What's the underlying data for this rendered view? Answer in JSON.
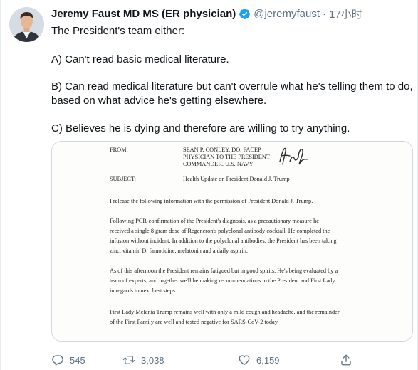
{
  "author": {
    "display_name": "Jeremy Faust MD MS (ER physician)",
    "handle": "@jeremyfaust",
    "separator": "·",
    "timestamp": "17小时"
  },
  "tweet_text": {
    "line1": "The President's team either:",
    "line2": "A) Can't read basic medical literature.",
    "line3": "B) Can read medical literature but can't overrule what he's telling them to do,",
    "line4": "based on what advice he's getting elsewhere.",
    "line5": "C) Believes he is dying and therefore are willing to try anything."
  },
  "memo": {
    "from_label": "FROM:",
    "from_line1": "SEAN P. CONLEY, DO, FACEP",
    "from_line2": "PHYSICIAN TO THE PRESIDENT",
    "from_line3": "COMMANDER, U.S. NAVY",
    "signature": "Sean P. Conley",
    "subject_label": "SUBJECT:",
    "subject_value": "Health Update on President Donald J. Trump",
    "p1": "I release the following information with the permission of President Donald J. Trump.",
    "p2_l1": "Following PCR-confirmation of the President's diagnosis, as a precautionary measure he",
    "p2_l2": "received a single 8 gram dose of Regeneron's polyclonal antibody cocktail.  He completed the",
    "p2_l3": "infusion without incident.  In addition to the polyclonal antibodies, the President has been taking",
    "p2_l4": "zinc, vitamin D, famotidine, melatonin and a daily aspirin.",
    "p3_l1": "As of this afternoon the President remains fatigued but in good spirits.  He's being evaluated by a",
    "p3_l2": "team of experts, and together we'll be making recommendations to the President and First Lady",
    "p3_l3": "in regards to next best steps.",
    "p4_l1": "First Lady Melania Trump remains well with only a mild cough and headache, and the remainder",
    "p4_l2": "of the First Family are well and tested negative for SARS-CoV-2 today."
  },
  "actions": {
    "reply_icon": "reply-icon",
    "reply_count": "545",
    "retweet_icon": "retweet-icon",
    "retweet_count": "3,038",
    "like_icon": "like-icon",
    "like_count": "6,159",
    "share_icon": "share-icon"
  },
  "colors": {
    "text": "#0f1419",
    "secondary": "#5b7083",
    "verified": "#1da1f2",
    "border": "#cfd9de"
  }
}
